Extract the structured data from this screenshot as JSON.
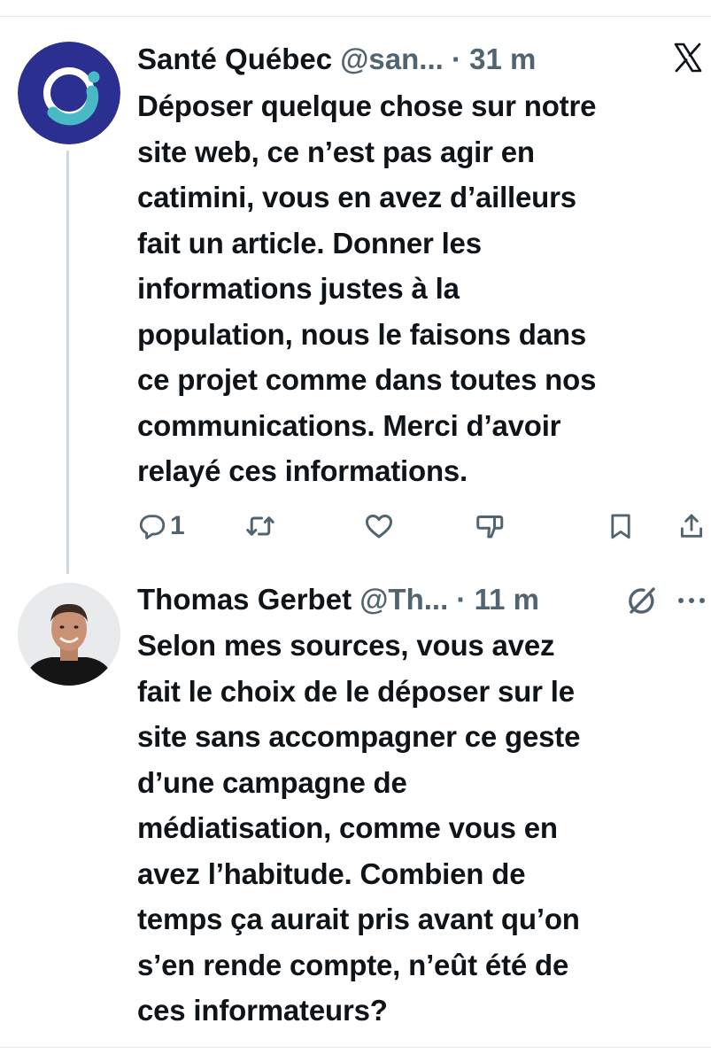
{
  "tweets": [
    {
      "name": "Santé Québec",
      "handle": "@san...",
      "separator": "·",
      "time": "31 m",
      "text": "Déposer quelque chose sur notre\nsite web, ce n’est pas agir en\ncatimini, vous en avez d’ailleurs\nfait un article. Donner les\ninformations justes à la\npopulation, nous le faisons dans\nce projet comme dans toutes nos\ncommunications. Merci d’avoir\nrelayé ces informations.",
      "avatar_icon": "sante-quebec-logo",
      "actions": {
        "reply_count": "1"
      }
    },
    {
      "name": "Thomas Gerbet",
      "handle": "@Th...",
      "separator": "·",
      "time": "11 m",
      "text": "Selon mes sources, vous avez\nfait le choix de le déposer sur le\nsite sans accompagner ce geste\nd’une campagne de\nmédiatisation, comme vous en\navez l’habitude. Combien de\ntemps ça aurait pris avant qu’on\ns’en rende compte, n’eût été de\nces informateurs?",
      "avatar_icon": "profile-photo"
    }
  ],
  "icons": {
    "header_right_1": "x-logo-icon",
    "header_right_2": "grok-icon",
    "more": "more-icon",
    "actions": [
      "reply-icon",
      "repost-icon",
      "like-icon",
      "views-icon",
      "bookmark-icon",
      "share-icon"
    ]
  },
  "colors": {
    "text": "#0f1419",
    "secondary": "#536471",
    "thread_line": "#cfd9de",
    "sante_quebec_brand": "#2b2f8f",
    "sante_quebec_accent": "#49b9c6"
  }
}
